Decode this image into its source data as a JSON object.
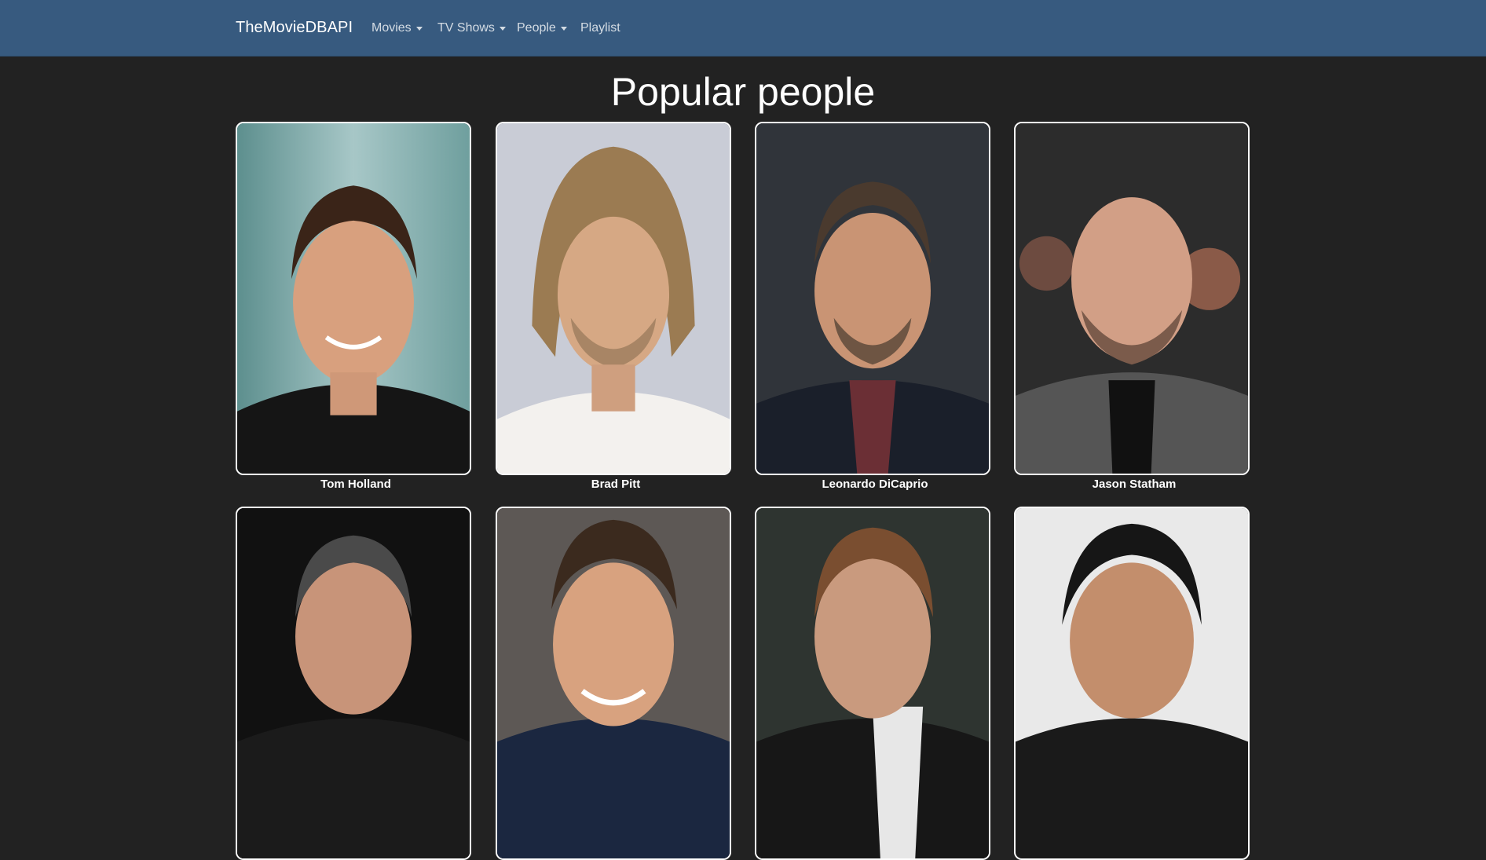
{
  "navbar": {
    "brand": "TheMovieDBAPI",
    "items": [
      {
        "label": "Movies",
        "dropdown": true
      },
      {
        "label": "TV Shows",
        "dropdown": true
      },
      {
        "label": "People",
        "dropdown": true
      },
      {
        "label": "Playlist",
        "dropdown": false
      }
    ],
    "background_color": "#375a7f"
  },
  "page": {
    "title": "Popular people",
    "background_color": "#222222"
  },
  "people": [
    {
      "name": "Tom Holland"
    },
    {
      "name": "Brad Pitt"
    },
    {
      "name": "Leonardo DiCaprio"
    },
    {
      "name": "Jason Statham"
    },
    {
      "name": ""
    },
    {
      "name": ""
    },
    {
      "name": ""
    },
    {
      "name": ""
    }
  ]
}
